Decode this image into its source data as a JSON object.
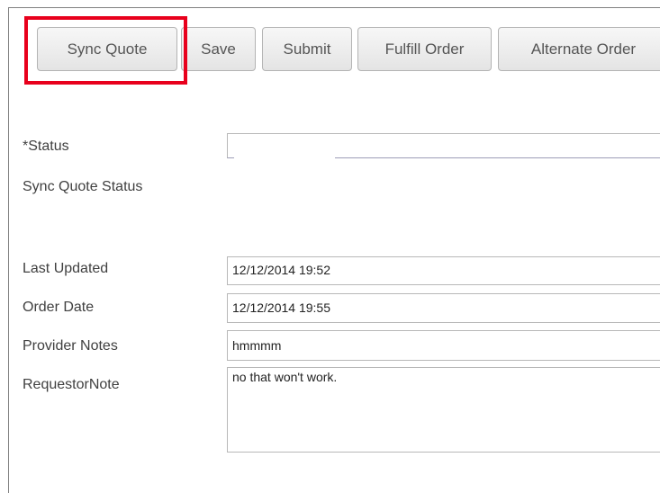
{
  "toolbar": {
    "sync_quote_label": "Sync Quote",
    "save_label": "Save",
    "submit_label": "Submit",
    "fulfill_order_label": "Fulfill Order",
    "alternate_order_label": "Alternate Order"
  },
  "form": {
    "status": {
      "label": "*Status",
      "value": ""
    },
    "sync_quote_status": {
      "label": "Sync Quote Status"
    },
    "last_updated": {
      "label": "Last Updated",
      "value": "12/12/2014 19:52"
    },
    "order_date": {
      "label": "Order Date",
      "value": "12/12/2014 19:55"
    },
    "provider_notes": {
      "label": "Provider Notes",
      "value": "hmmmm"
    },
    "requestor_note": {
      "label": "RequestorNote",
      "value": "no that won't work."
    }
  },
  "colors": {
    "highlight": "#e8001c"
  }
}
